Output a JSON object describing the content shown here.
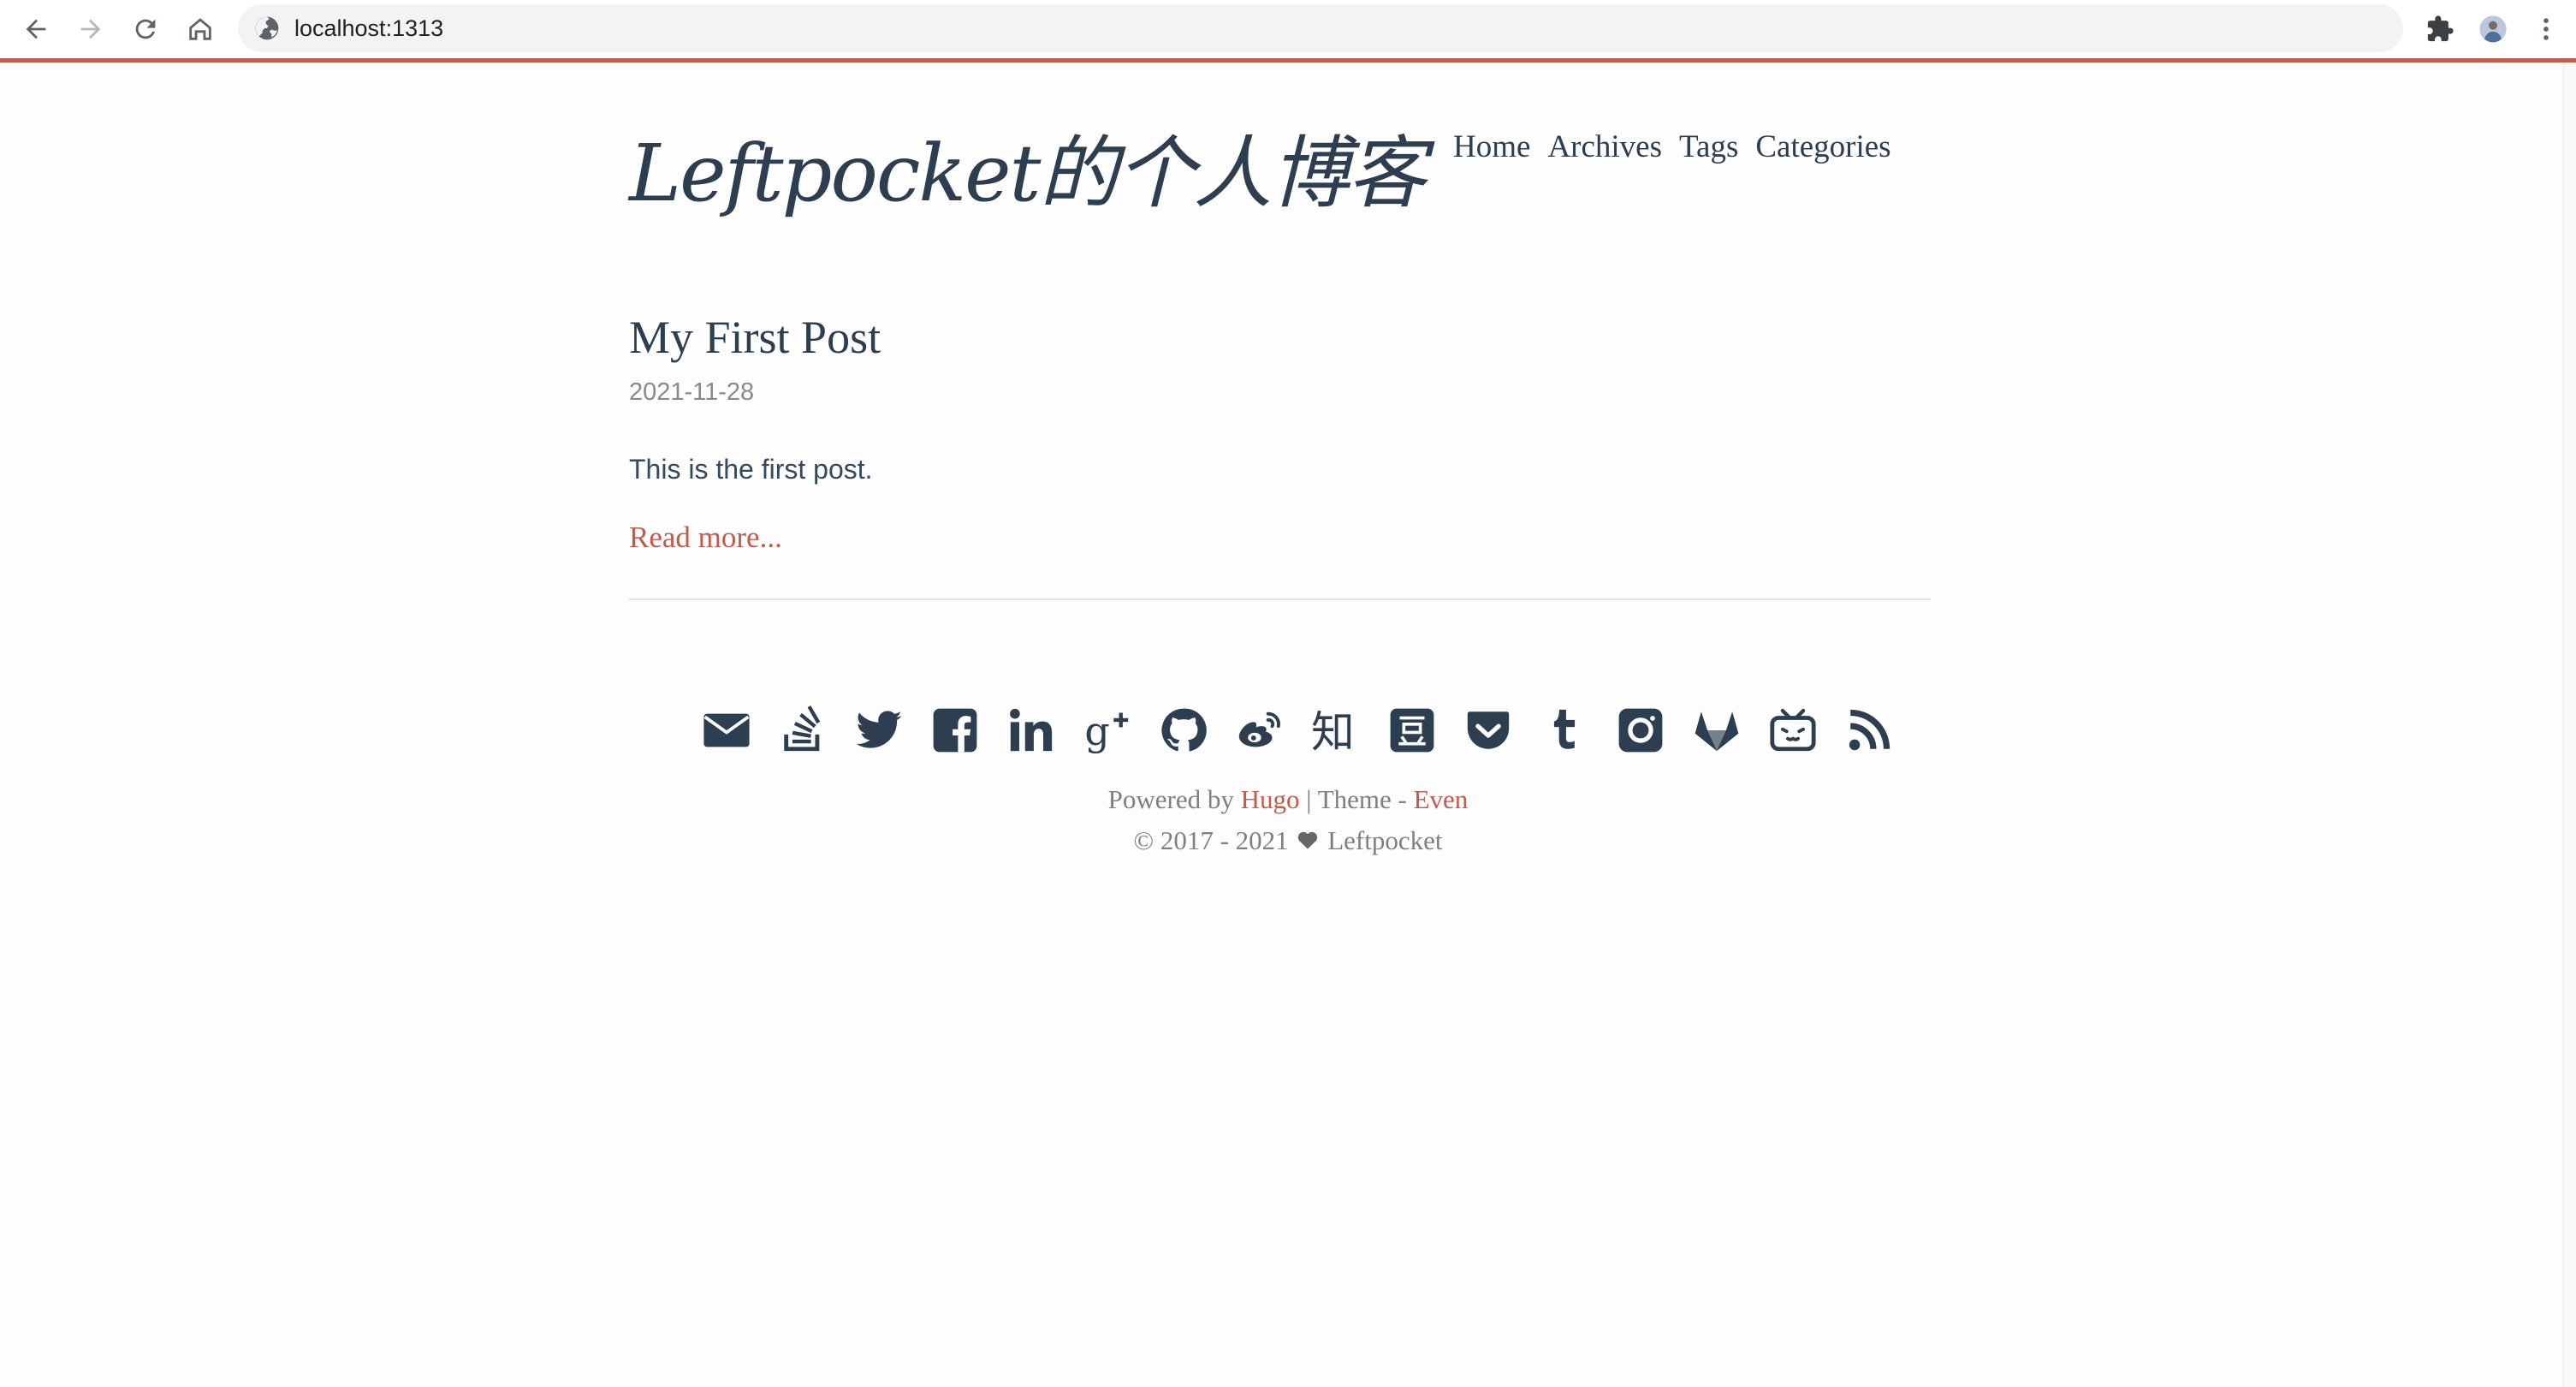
{
  "browser": {
    "url": "localhost:1313"
  },
  "site": {
    "logo": "Leftpocket的个人博客",
    "menu": [
      "Home",
      "Archives",
      "Tags",
      "Categories"
    ]
  },
  "post": {
    "title": "My First Post",
    "date": "2021-11-28",
    "summary": "This is the first post.",
    "read_more": "Read more..."
  },
  "social_icons": [
    "email-icon",
    "stack-overflow-icon",
    "twitter-icon",
    "facebook-icon",
    "linkedin-icon",
    "google-plus-icon",
    "github-icon",
    "weibo-icon",
    "zhihu-icon",
    "douban-icon",
    "pocket-icon",
    "tumblr-icon",
    "instagram-icon",
    "gitlab-icon",
    "bilibili-icon",
    "rss-icon"
  ],
  "footer": {
    "powered_by": "Powered by",
    "hugo": "Hugo",
    "separator": "|",
    "theme_label": "Theme -",
    "theme": "Even",
    "copyright": "© 2017 - 2021",
    "author": "Leftpocket"
  },
  "colors": {
    "accent": "#c05b4d",
    "text": "#2c3e50",
    "background": "#fdfdfd"
  }
}
